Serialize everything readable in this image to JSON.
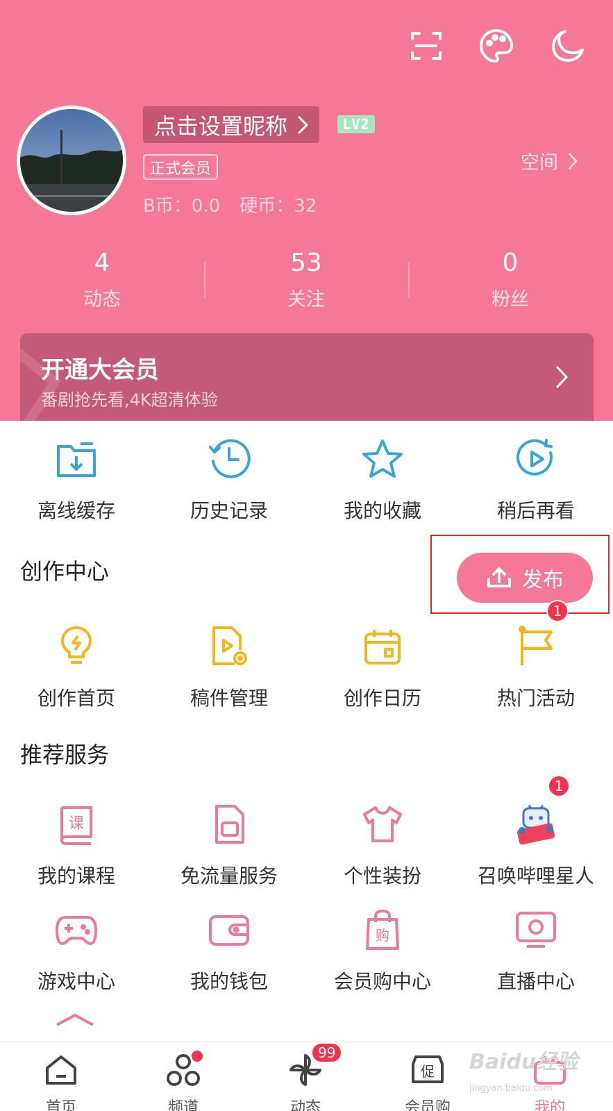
{
  "profile": {
    "nickname": "点击设置昵称",
    "level": "LV2",
    "membership": "正式会员",
    "bcoin": "B币：0.0",
    "coin": "硬币：32",
    "space_label": "空间"
  },
  "stats": [
    {
      "value": "4",
      "label": "动态"
    },
    {
      "value": "53",
      "label": "关注"
    },
    {
      "value": "0",
      "label": "粉丝"
    }
  ],
  "vip": {
    "title": "开通大会员",
    "subtitle": "番剧抢先看,4K超清体验"
  },
  "quick_actions": [
    {
      "label": "离线缓存",
      "icon": "download-folder-icon"
    },
    {
      "label": "历史记录",
      "icon": "history-clock-icon"
    },
    {
      "label": "我的收藏",
      "icon": "star-icon"
    },
    {
      "label": "稍后再看",
      "icon": "watch-later-icon"
    }
  ],
  "creation": {
    "title": "创作中心",
    "publish_label": "发布",
    "items": [
      {
        "label": "创作首页",
        "icon": "lightbulb-icon"
      },
      {
        "label": "稿件管理",
        "icon": "manuscript-icon"
      },
      {
        "label": "创作日历",
        "icon": "calendar-icon"
      },
      {
        "label": "热门活动",
        "icon": "flag-icon",
        "badge": "1"
      }
    ]
  },
  "services": {
    "title": "推荐服务",
    "row1": [
      {
        "label": "我的课程",
        "icon": "course-book-icon"
      },
      {
        "label": "免流量服务",
        "icon": "sim-card-icon"
      },
      {
        "label": "个性装扮",
        "icon": "tshirt-icon"
      },
      {
        "label": "召唤哔哩星人",
        "icon": "mascot-icon",
        "badge": "1"
      }
    ],
    "row2": [
      {
        "label": "游戏中心",
        "icon": "gamepad-icon"
      },
      {
        "label": "我的钱包",
        "icon": "wallet-icon"
      },
      {
        "label": "会员购中心",
        "icon": "shopping-bag-icon"
      },
      {
        "label": "直播中心",
        "icon": "live-tv-icon"
      }
    ]
  },
  "tabbar": [
    {
      "label": "首页",
      "icon": "home-icon"
    },
    {
      "label": "频道",
      "icon": "channel-icon"
    },
    {
      "label": "动态",
      "icon": "pinwheel-icon",
      "badge": "99"
    },
    {
      "label": "会员购",
      "icon": "promo-icon"
    },
    {
      "label": "我的",
      "icon": "tv-mine-icon"
    }
  ],
  "watermark": {
    "text": "Baidu经验",
    "sub": "jingyan.baidu.com"
  },
  "colors": {
    "brand_pink": "#f57898",
    "icon_blue": "#3ba3dc",
    "icon_yellow": "#f6b51d",
    "badge_red": "#f2334d"
  }
}
